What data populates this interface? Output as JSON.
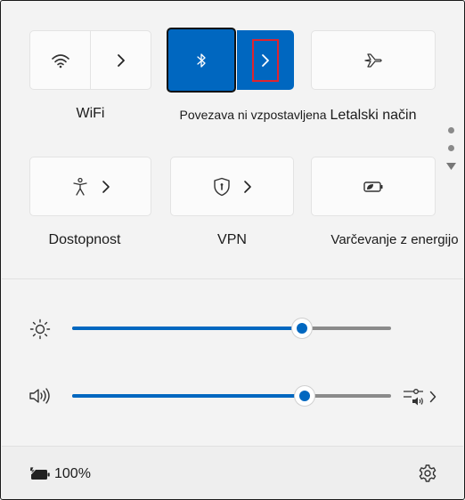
{
  "tiles": {
    "wifi": {
      "label": "WiFi"
    },
    "bluetooth": {
      "label": "Povezava ni vzpostavljena"
    },
    "airplane": {
      "label": "Letalski način"
    },
    "accessibility": {
      "label": "Dostopnost"
    },
    "vpn": {
      "label": "VPN"
    },
    "energy_saver": {
      "label": "Varčevanje z energijo"
    }
  },
  "sliders": {
    "brightness": {
      "value": 0.72
    },
    "volume": {
      "value": 0.73
    }
  },
  "footer": {
    "battery": "100%"
  },
  "colors": {
    "accent": "#0067c0",
    "highlight_border": "#e0242e"
  }
}
